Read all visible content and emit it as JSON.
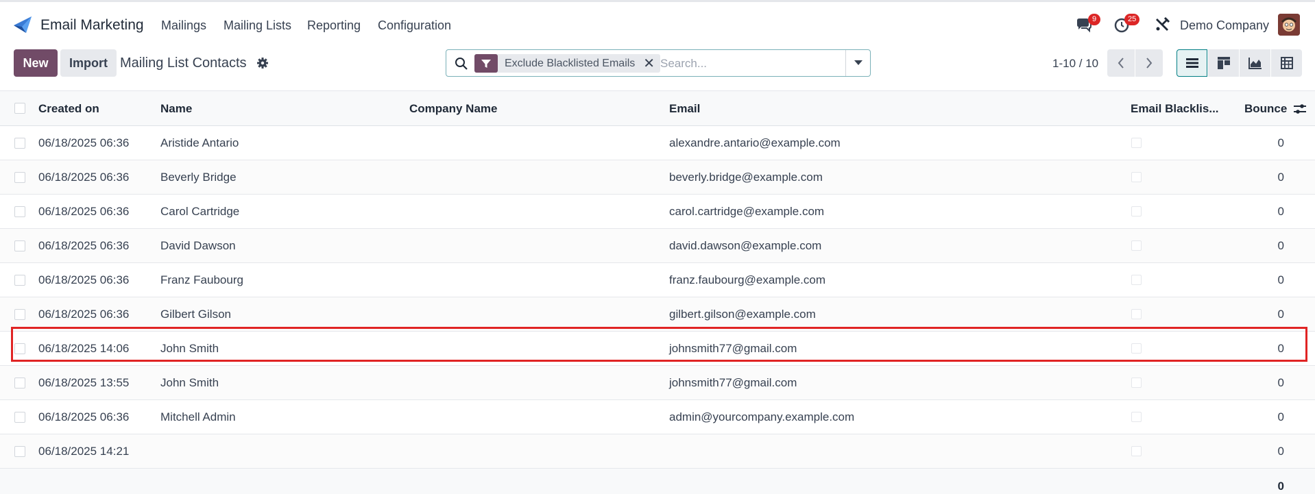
{
  "app": {
    "name": "Email Marketing"
  },
  "menu": [
    "Mailings",
    "Mailing Lists",
    "Reporting",
    "Configuration"
  ],
  "systray": {
    "messages_count": "9",
    "activities_count": "25",
    "company": "Demo Company"
  },
  "control": {
    "new_label": "New",
    "import_label": "Import",
    "title": "Mailing List Contacts",
    "facet_label": "Exclude Blacklisted Emails",
    "search_placeholder": "Search...",
    "pager": "1-10 / 10"
  },
  "columns": {
    "created_on": "Created on",
    "name": "Name",
    "company_name": "Company Name",
    "email": "Email",
    "blacklisted": "Email Blacklis...",
    "bounce": "Bounce"
  },
  "rows": [
    {
      "created": "06/18/2025 06:36",
      "name": "Aristide Antario",
      "company": "",
      "email": "alexandre.antario@example.com",
      "bounce": "0"
    },
    {
      "created": "06/18/2025 06:36",
      "name": "Beverly Bridge",
      "company": "",
      "email": "beverly.bridge@example.com",
      "bounce": "0"
    },
    {
      "created": "06/18/2025 06:36",
      "name": "Carol Cartridge",
      "company": "",
      "email": "carol.cartridge@example.com",
      "bounce": "0"
    },
    {
      "created": "06/18/2025 06:36",
      "name": "David Dawson",
      "company": "",
      "email": "david.dawson@example.com",
      "bounce": "0"
    },
    {
      "created": "06/18/2025 06:36",
      "name": "Franz Faubourg",
      "company": "",
      "email": "franz.faubourg@example.com",
      "bounce": "0"
    },
    {
      "created": "06/18/2025 06:36",
      "name": "Gilbert Gilson",
      "company": "",
      "email": "gilbert.gilson@example.com",
      "bounce": "0"
    },
    {
      "created": "06/18/2025 14:06",
      "name": "John Smith",
      "company": "",
      "email": "johnsmith77@gmail.com",
      "bounce": "0"
    },
    {
      "created": "06/18/2025 13:55",
      "name": "John Smith",
      "company": "",
      "email": "johnsmith77@gmail.com",
      "bounce": "0"
    },
    {
      "created": "06/18/2025 06:36",
      "name": "Mitchell Admin",
      "company": "",
      "email": "admin@yourcompany.example.com",
      "bounce": "0"
    },
    {
      "created": "06/18/2025 14:21",
      "name": "",
      "company": "",
      "email": "",
      "bounce": "0"
    }
  ],
  "totals": {
    "bounce": "0"
  },
  "colors": {
    "primary": "#714b67",
    "highlight": "#e02424",
    "badge": "#dc2626"
  }
}
